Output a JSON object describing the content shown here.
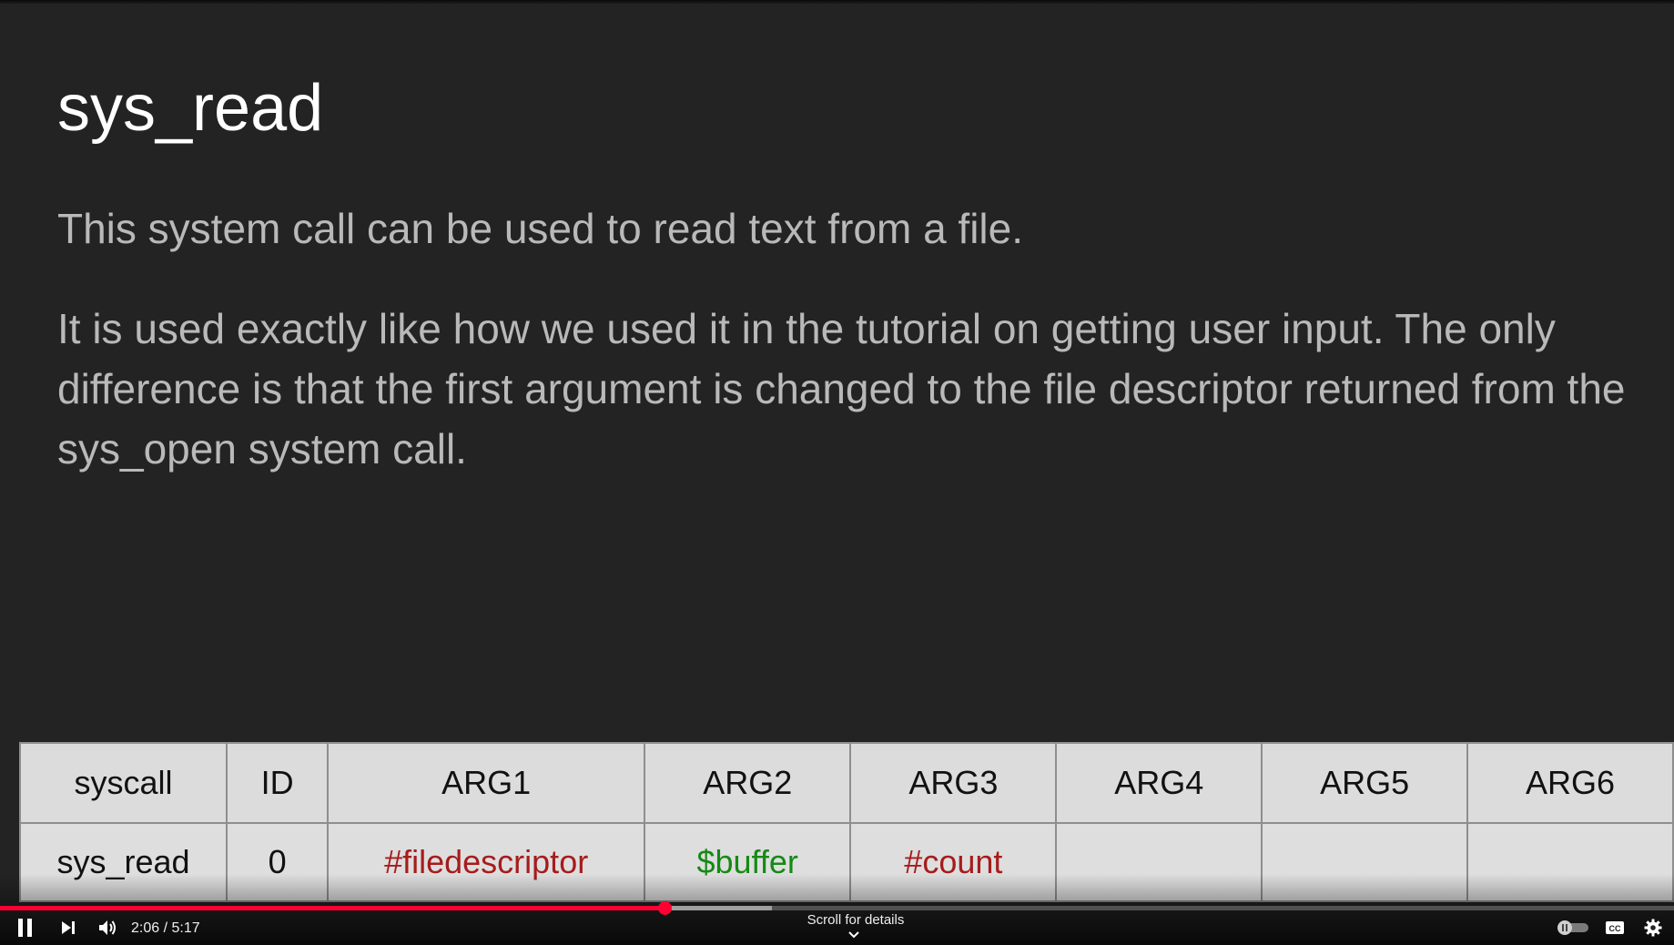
{
  "slide": {
    "title": "sys_read",
    "paragraph1": "This system call can be used to read text from a file.",
    "paragraph2": "It is used exactly like how we used it in the tutorial on getting user input. The only difference is that the first argument is changed to the file descriptor returned from the sys_open system call.",
    "table": {
      "headers": [
        "syscall",
        "ID",
        "ARG1",
        "ARG2",
        "ARG3",
        "ARG4",
        "ARG5",
        "ARG6"
      ],
      "row": [
        "sys_read",
        "0",
        "#filedescriptor",
        "$buffer",
        "#count",
        "",
        "",
        ""
      ],
      "row_colors": [
        "#111111",
        "#111111",
        "#a61c1c",
        "#148a14",
        "#a61c1c",
        "#111111",
        "#111111",
        "#111111"
      ]
    }
  },
  "player": {
    "current_time": "2:06",
    "duration": "5:17",
    "time_display": "2:06 / 5:17",
    "played_fraction": 0.397,
    "buffered_fraction": 0.461,
    "scroll_hint": "Scroll for details",
    "icons": {
      "play_pause": "pause-icon",
      "next": "next-icon",
      "volume": "volume-icon",
      "autoplay": "autoplay-toggle",
      "captions": "cc-icon",
      "settings": "gear-icon"
    }
  },
  "colors": {
    "progress_played": "#ff0033",
    "slide_background": "#232323",
    "title_text": "#ffffff",
    "body_text": "#b9b9b9"
  }
}
